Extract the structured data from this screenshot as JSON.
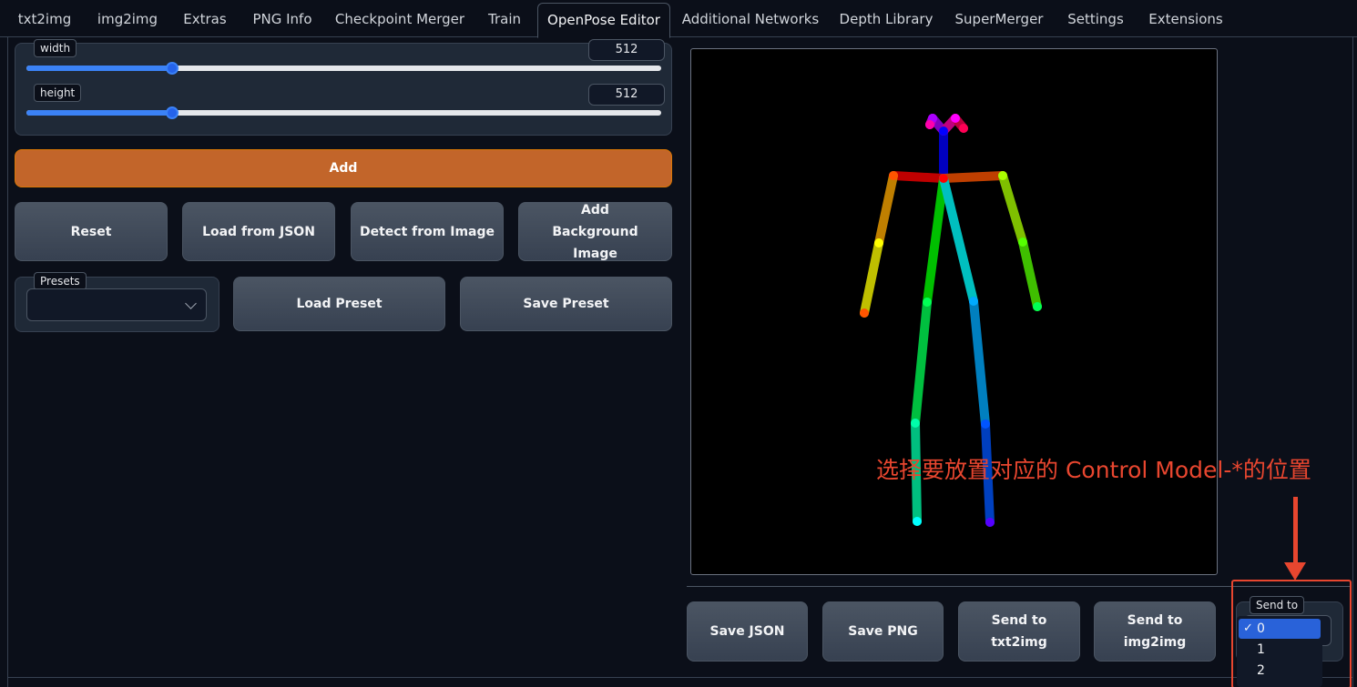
{
  "tabs": [
    {
      "label": "txt2img"
    },
    {
      "label": "img2img"
    },
    {
      "label": "Extras"
    },
    {
      "label": "PNG Info"
    },
    {
      "label": "Checkpoint Merger"
    },
    {
      "label": "Train"
    },
    {
      "label": "OpenPose Editor",
      "active": true
    },
    {
      "label": "Additional Networks"
    },
    {
      "label": "Depth Library"
    },
    {
      "label": "SuperMerger"
    },
    {
      "label": "Settings"
    },
    {
      "label": "Extensions"
    }
  ],
  "sliders": {
    "width": {
      "label": "width",
      "value": "512",
      "fraction": 0.23
    },
    "height": {
      "label": "height",
      "value": "512",
      "fraction": 0.23
    }
  },
  "buttons": {
    "add": "Add",
    "reset": "Reset",
    "load_json": "Load from JSON",
    "detect_image": "Detect from Image",
    "add_background": "Add Background Image",
    "load_preset": "Load Preset",
    "save_preset": "Save Preset",
    "save_json": "Save JSON",
    "save_png": "Save PNG",
    "send_txt2img": "Send to txt2img",
    "send_img2img": "Send to img2img"
  },
  "presets": {
    "label": "Presets",
    "value": ""
  },
  "send_to": {
    "label": "Send to",
    "options": [
      "0",
      "1",
      "2"
    ],
    "selected": "0",
    "check": "✓"
  },
  "annotation": {
    "text": "选择要放置对应的 Control Model-*的位置",
    "color": "#e8462f"
  },
  "colors": {
    "primary": "#c2652a",
    "slider_accent": "#3b82f6",
    "background": "#0b0f19",
    "panel": "#1f2937",
    "selection": "#2962d9"
  },
  "icons": {
    "presets_dropdown": "chevron-down-icon",
    "send_arrow": "arrow-down-icon",
    "checkmark": "check-icon"
  }
}
